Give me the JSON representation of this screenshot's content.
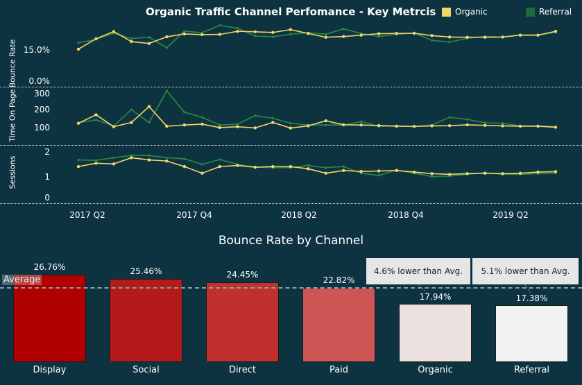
{
  "title": "Organic Traffic Channel Perfomance - Key Metrcis",
  "legend": [
    {
      "label": "Organic",
      "color": "#f5d46a"
    },
    {
      "label": "Referral",
      "color": "#1d6b38"
    }
  ],
  "line_panels": {
    "bounce_rate": {
      "label": "Bounce Rate",
      "ticks": [
        "15.0%",
        "0.0%"
      ]
    },
    "time_on_page": {
      "label": "Time On Page",
      "ticks": [
        "300",
        "200",
        "100"
      ]
    },
    "sessions": {
      "label": "Sessions",
      "ticks": [
        "2",
        "1",
        "0"
      ]
    },
    "x_ticks": [
      "2017 Q2",
      "2017 Q4",
      "2018 Q2",
      "2018 Q4",
      "2019 Q2"
    ]
  },
  "bar_chart": {
    "title": "Bounce Rate by Channel",
    "average_label": "Average",
    "callouts": [
      {
        "text": "4.6% lower than Avg.",
        "target": "Organic"
      },
      {
        "text": "5.1% lower than Avg.",
        "target": "Referral"
      }
    ]
  },
  "chart_data": [
    {
      "type": "line",
      "title": "Organic Traffic Channel Perfomance - Key Metrcis",
      "x_ticks": [
        "2017 Q2",
        "2017 Q4",
        "2018 Q2",
        "2018 Q4",
        "2019 Q2"
      ],
      "panels": [
        {
          "metric": "Bounce Rate",
          "unit": "%",
          "ylim": [
            0,
            25
          ],
          "series": [
            {
              "name": "Organic",
              "color": "#f5d46a",
              "values": [
                13.1,
                17.5,
                20.5,
                16.3,
                15.5,
                18.3,
                19.5,
                19.2,
                19.3,
                20.6,
                20.4,
                20.1,
                21.3,
                19.7,
                18.1,
                18.4,
                19.0,
                19.6,
                19.7,
                19.8,
                18.8,
                18.2,
                18.1,
                18.1,
                18.2,
                19.0,
                19.0,
                20.6
              ]
            },
            {
              "name": "Referral",
              "color": "#1d6b38",
              "values": [
                15.8,
                17.2,
                19.8,
                17.6,
                18.1,
                13.7,
                20.7,
                20.0,
                23.1,
                21.9,
                18.6,
                18.3,
                19.4,
                20.0,
                19.4,
                21.6,
                19.7,
                18.4,
                19.3,
                19.9,
                16.8,
                16.1,
                17.7,
                18.4,
                18.2,
                19.1,
                19.1,
                20.1
              ]
            }
          ]
        },
        {
          "metric": "Time On Page",
          "ylim": [
            0,
            350
          ],
          "series": [
            {
              "name": "Organic",
              "color": "#f5d46a",
              "values": [
                115,
                165,
                95,
                120,
                213,
                98,
                105,
                110,
                90,
                95,
                88,
                120,
                87,
                100,
                130,
                106,
                105,
                102,
                98,
                97,
                100,
                101,
                106,
                103,
                100,
                98,
                98,
                92
              ]
            },
            {
              "name": "Referral",
              "color": "#1d6b38",
              "values": [
                118,
                135,
                100,
                195,
                120,
                305,
                180,
                150,
                105,
                110,
                160,
                145,
                115,
                105,
                105,
                105,
                125,
                96,
                101,
                95,
                105,
                150,
                138,
                118,
                115,
                100,
                100,
                95
              ]
            }
          ]
        },
        {
          "metric": "Sessions",
          "ylim": [
            0,
            2.6
          ],
          "series": [
            {
              "name": "Organic",
              "color": "#f5d46a",
              "values": [
                1.5,
                1.65,
                1.62,
                1.9,
                1.8,
                1.75,
                1.5,
                1.2,
                1.5,
                1.55,
                1.47,
                1.5,
                1.5,
                1.4,
                1.2,
                1.32,
                1.28,
                1.3,
                1.32,
                1.25,
                1.18,
                1.15,
                1.18,
                1.2,
                1.18,
                1.2,
                1.25,
                1.27
              ]
            },
            {
              "name": "Referral",
              "color": "#1d6b38",
              "values": [
                1.8,
                1.78,
                1.9,
                2.0,
                2.0,
                1.9,
                1.85,
                1.6,
                1.82,
                1.6,
                1.48,
                1.45,
                1.45,
                1.55,
                1.45,
                1.5,
                1.2,
                1.1,
                1.35,
                1.2,
                1.05,
                1.07,
                1.15,
                1.22,
                1.15,
                1.15,
                1.18,
                1.2
              ]
            }
          ]
        }
      ]
    },
    {
      "type": "bar",
      "title": "Bounce Rate by Channel",
      "categories": [
        "Display",
        "Social",
        "Direct",
        "Paid",
        "Organic",
        "Referral"
      ],
      "values": [
        26.76,
        25.46,
        24.45,
        22.82,
        17.94,
        17.38
      ],
      "labels": [
        "26.76%",
        "25.46%",
        "24.45%",
        "22.82%",
        "17.94%",
        "17.38%"
      ],
      "colors": [
        "#b10000",
        "#b51a1a",
        "#c0302c",
        "#cd5554",
        "#ede0e0",
        "#f2f2f2"
      ],
      "average": 24.3,
      "ylim": [
        0,
        27
      ]
    }
  ]
}
